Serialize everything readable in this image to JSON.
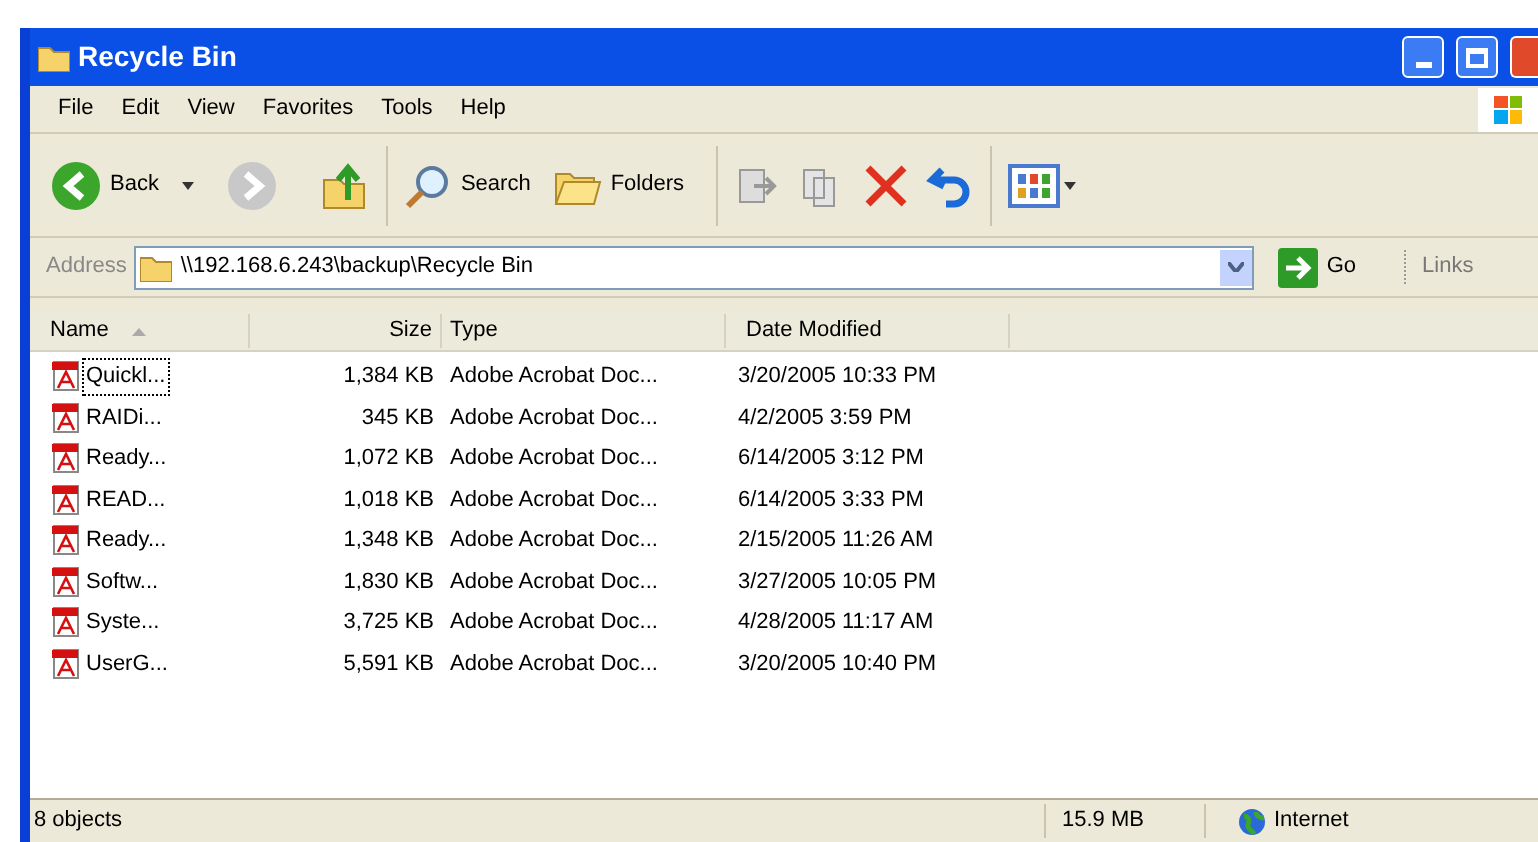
{
  "window": {
    "title": "Recycle Bin"
  },
  "menu": [
    "File",
    "Edit",
    "View",
    "Favorites",
    "Tools",
    "Help"
  ],
  "toolbar": {
    "back": "Back",
    "search": "Search",
    "folders": "Folders"
  },
  "address": {
    "label": "Address",
    "value": "\\\\192.168.6.243\\backup\\Recycle Bin",
    "go": "Go",
    "links": "Links"
  },
  "table": {
    "columns": [
      "Name",
      "Size",
      "Type",
      "Date Modified"
    ],
    "rows": [
      {
        "name": "Quickl...",
        "size": "1,384 KB",
        "type": "Adobe Acrobat Doc...",
        "date": "3/20/2005 10:33 PM",
        "selected": true
      },
      {
        "name": "RAIDi...",
        "size": "345 KB",
        "type": "Adobe Acrobat Doc...",
        "date": "4/2/2005 3:59 PM",
        "selected": false
      },
      {
        "name": "Ready...",
        "size": "1,072 KB",
        "type": "Adobe Acrobat Doc...",
        "date": "6/14/2005 3:12 PM",
        "selected": false
      },
      {
        "name": "READ...",
        "size": "1,018 KB",
        "type": "Adobe Acrobat Doc...",
        "date": "6/14/2005 3:33 PM",
        "selected": false
      },
      {
        "name": "Ready...",
        "size": "1,348 KB",
        "type": "Adobe Acrobat Doc...",
        "date": "2/15/2005 11:26 AM",
        "selected": false
      },
      {
        "name": "Softw...",
        "size": "1,830 KB",
        "type": "Adobe Acrobat Doc...",
        "date": "3/27/2005 10:05 PM",
        "selected": false
      },
      {
        "name": "Syste...",
        "size": "3,725 KB",
        "type": "Adobe Acrobat Doc...",
        "date": "4/28/2005 11:17 AM",
        "selected": false
      },
      {
        "name": "UserG...",
        "size": "5,591 KB",
        "type": "Adobe Acrobat Doc...",
        "date": "3/20/2005 10:40 PM",
        "selected": false
      }
    ]
  },
  "status_bar": {
    "objects": "8 objects",
    "size": "15.9 MB",
    "zone": "Internet"
  }
}
